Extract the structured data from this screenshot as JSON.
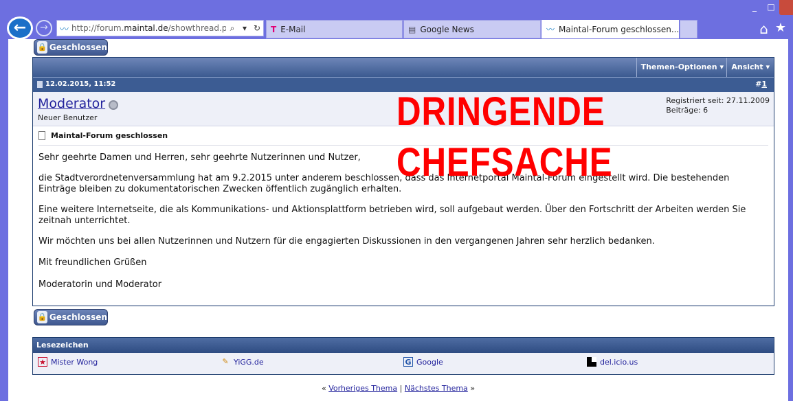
{
  "browser": {
    "url_prefix": "http://forum.",
    "url_host": "maintal.de",
    "url_suffix": "/showthread.php?",
    "tabs": [
      {
        "label": "E-Mail"
      },
      {
        "label": "Google News"
      },
      {
        "label": "Maintal-Forum geschlossen..."
      }
    ],
    "window_controls": {
      "minimize": "_",
      "maximize": "□",
      "close": ""
    }
  },
  "page": {
    "closed_button_label": "Geschlossen",
    "thread_tools": {
      "options": "Themen-Optionen ▾",
      "view": "Ansicht ▾"
    },
    "post": {
      "date": "12.02.2015, 11:52",
      "number_prefix": "#",
      "number": "1",
      "author": "Moderator",
      "author_role": "Neuer Benutzer",
      "registered": "Registriert seit: 27.11.2009",
      "posts_count": "Beiträge: 6",
      "title": "Maintal-Forum geschlossen",
      "paragraphs": [
        "Sehr geehrte Damen und Herren, sehr geehrte Nutzerinnen und Nutzer,",
        "die Stadtverordnetenversammlung hat am 9.2.2015 unter anderem beschlossen, dass das Internetportal Maintal-Forum eingestellt wird. Die bestehenden Einträge bleiben zu dokumentatorischen Zwecken öffentlich zugänglich erhalten.",
        "Eine weitere Internetseite, die als Kommunikations- und Aktionsplattform betrieben wird, soll aufgebaut werden. Über den Fortschritt der Arbeiten werden Sie zeitnah unterrichtet.",
        "Wir möchten uns bei allen Nutzerinnen und Nutzern für die engagierten Diskussionen in den vergangenen Jahren sehr herzlich bedanken.",
        "Mit freundlichen Grüßen",
        "Moderatorin und Moderator"
      ]
    },
    "overlay": {
      "line1": "DRINGENDE",
      "line2": "CHEFSACHE"
    },
    "bookmarks": {
      "heading": "Lesezeichen",
      "items": [
        {
          "label": "Mister Wong"
        },
        {
          "label": "YiGG.de"
        },
        {
          "label": "Google"
        },
        {
          "label": "del.icio.us"
        }
      ]
    },
    "thread_nav": {
      "prev": "Vorheriges Thema",
      "separator": "|",
      "next": "Nächstes Thema"
    }
  }
}
